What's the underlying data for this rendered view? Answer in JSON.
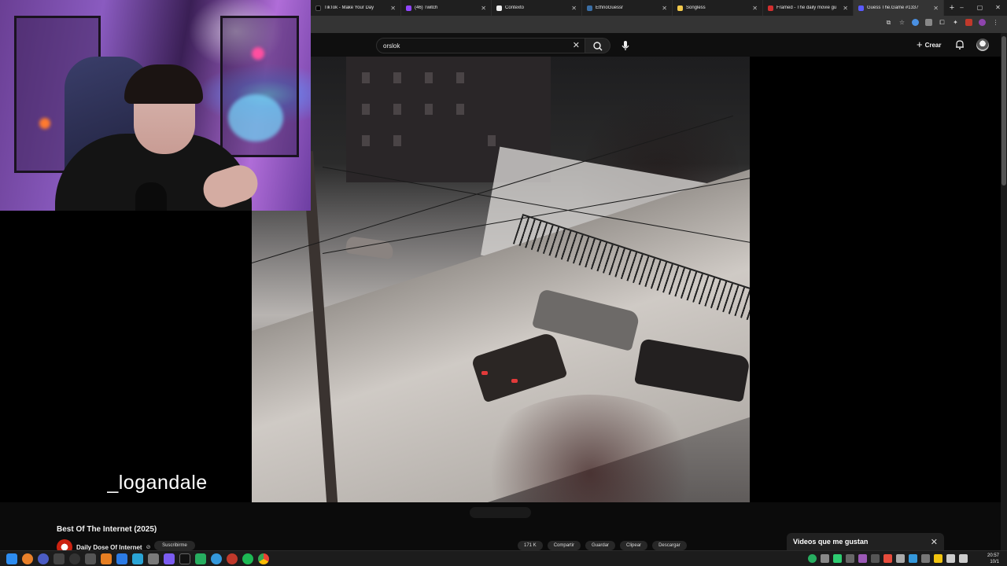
{
  "browser": {
    "tabs": [
      {
        "title": "TikTok - Make Your Day",
        "icon": "tiktok-icon",
        "color": "#000000"
      },
      {
        "title": "(46) Twitch",
        "icon": "twitch-icon",
        "color": "#9146ff"
      },
      {
        "title": "Contexto",
        "icon": "contexto-icon",
        "color": "#2a2a2a"
      },
      {
        "title": "EthnoGuessr",
        "icon": "ethnoguessr-icon",
        "color": "#3a6ea5"
      },
      {
        "title": "Songless",
        "icon": "songless-icon",
        "color": "#f2c94c"
      },
      {
        "title": "Framed - The daily movie gu",
        "icon": "framed-icon",
        "color": "#d32f2f"
      },
      {
        "title": "Guess The.Game #1337",
        "icon": "guessthegame-icon",
        "color": "#5a5aff"
      }
    ],
    "new_tab_label": "+",
    "window_controls": [
      "–",
      "▢",
      "✕"
    ]
  },
  "youtube": {
    "search": {
      "value": "orslok",
      "clear": "✕"
    },
    "create_label": "Crear",
    "video": {
      "title": "Best Of The Internet (2025)",
      "channel": "Daily Dose Of Internet",
      "verified": "⊘",
      "subscribe_label": "Suscribirme",
      "actions": [
        "171 K",
        "Compartir",
        "Guardar",
        "Clipear",
        "Descargar"
      ]
    },
    "popup": {
      "label": "Videos que me gustan",
      "close": "✕"
    }
  },
  "stream_overlay": {
    "username": "_logandale"
  },
  "taskbar": {
    "time": "20:57",
    "date": "10/1"
  }
}
